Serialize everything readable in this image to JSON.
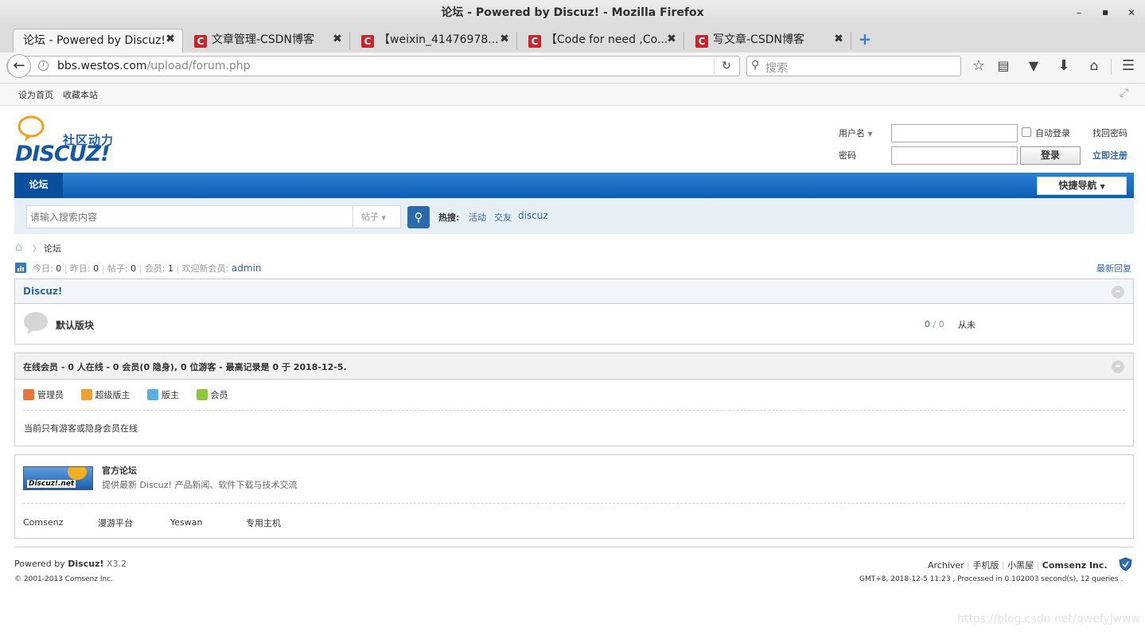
{
  "window": {
    "title": "论坛 - Powered by Discuz! - Mozilla Firefox"
  },
  "tabs": [
    {
      "label": "论坛 - Powered by Discuz!",
      "active": true
    },
    {
      "label": "文章管理-CSDN博客"
    },
    {
      "label": "【weixin_41476978..."
    },
    {
      "label": "【Code for need ,Co..."
    },
    {
      "label": "写文章-CSDN博客"
    }
  ],
  "nav": {
    "url_domain": "bbs.westos.com",
    "url_path": "/upload/forum.php",
    "search_placeholder": "搜索"
  },
  "topbar": {
    "set_home": "设为首页",
    "favorite": "收藏本站"
  },
  "logo": {
    "slogan": "社区动力",
    "wordmark": "DISCUZ!"
  },
  "login": {
    "username_label": "用户名",
    "password_label": "密码",
    "auto_login": "自动登录",
    "find_password": "找回密码",
    "register": "立即注册",
    "login_button": "登录"
  },
  "menu": {
    "forum_tab": "论坛",
    "quick_nav": "快捷导航"
  },
  "search": {
    "placeholder": "请输入搜索内容",
    "type": "帖子",
    "hot_label": "热搜:",
    "hot": [
      "活动",
      "交友",
      "discuz"
    ]
  },
  "breadcrumb": {
    "current": "论坛"
  },
  "stats": {
    "today_label": "今日:",
    "today": "0",
    "yesterday_label": "昨日:",
    "yesterday": "0",
    "posts_label": "帖子:",
    "posts": "0",
    "members_label": "会员:",
    "members": "1",
    "welcome_label": "欢迎新会员:",
    "newest_member": "admin",
    "latest_reply": "最新回复"
  },
  "category": {
    "title": "Discuz!",
    "forum_name": "默认版块",
    "threads": "0",
    "posts": "0",
    "last_post": "从未"
  },
  "online": {
    "title": "在线会员 - 0 人在线 - 0 会员(0 隐身), 0 位游客 - 最高记录是 0 于 2018-12-5.",
    "legend": [
      {
        "label": "管理员",
        "color": "#e8753a"
      },
      {
        "label": "超级版主",
        "color": "#f0a030"
      },
      {
        "label": "版主",
        "color": "#5aaee0"
      },
      {
        "label": "会员",
        "color": "#8dc63f"
      }
    ],
    "empty_text": "当前只有游客或隐身会员在线"
  },
  "links": {
    "banner_text": "Discuz!.net",
    "official_title": "官方论坛",
    "official_desc": "提供最新 Discuz! 产品新闻、软件下载与技术交流",
    "items": [
      "Comsenz",
      "漫游平台",
      "Yeswan",
      "专用主机"
    ]
  },
  "footer": {
    "powered_prefix": "Powered by",
    "powered_name": "Discuz!",
    "powered_version": "X3.2",
    "copyright": "© 2001-2013 Comsenz Inc.",
    "links": [
      "Archiver",
      "手机版",
      "小黑屋"
    ],
    "company": "Comsenz Inc.",
    "stats_line": "GMT+8, 2018-12-5 11:23 , Processed in 0.102003 second(s), 12 queries .",
    "watermark": "https://blog.csdn.net/qwefyjwww"
  }
}
